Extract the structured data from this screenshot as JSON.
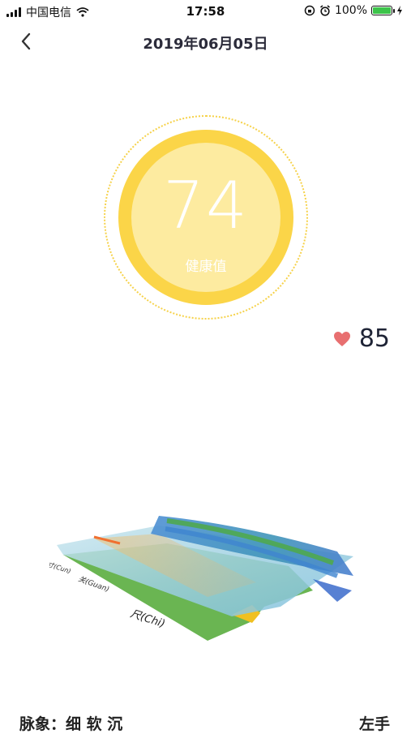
{
  "status_bar": {
    "carrier": "中国电信",
    "time": "17:58",
    "battery": "100%"
  },
  "nav": {
    "title": "2019年06月05日"
  },
  "score": {
    "value": "74",
    "label": "健康值"
  },
  "heart_rate": {
    "value": "85"
  },
  "pulse_chart": {
    "axis_labels": [
      "寸(Cun)",
      "关(Guan)",
      "尺(Chi)"
    ]
  },
  "pulse_result": {
    "text": "脉象：细 软 沉"
  },
  "hand": {
    "label": "左手"
  },
  "colors": {
    "score_ring": "#fbd548",
    "score_inner": "#fdeba0",
    "heart": "#e86f70",
    "battery": "#3cc44a"
  }
}
